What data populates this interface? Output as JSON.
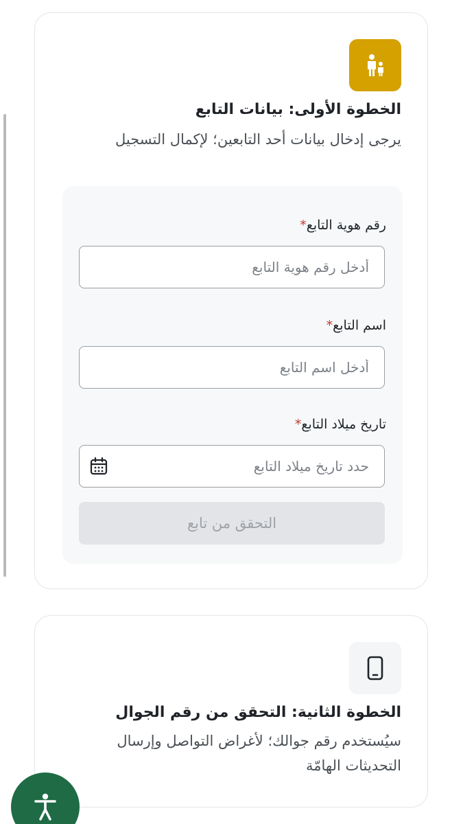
{
  "step1": {
    "icon": "parent-child-icon",
    "title": "الخطوة الأولى: بيانات التابع",
    "description": "يرجى إدخال بيانات أحد التابعين؛ لإكمال التسجيل",
    "fields": [
      {
        "label": "رقم هوية التابع",
        "required_mark": "*",
        "value": "",
        "placeholder": "أدخل رقم هوية التابع"
      },
      {
        "label": "اسم التابع",
        "required_mark": "*",
        "value": "",
        "placeholder": "أدخل اسم التابع"
      },
      {
        "label": "تاريخ ميلاد التابع",
        "required_mark": "*",
        "value": "",
        "placeholder": "حدد تاريخ ميلاد التابع",
        "icon": "calendar-icon"
      }
    ],
    "verify_button": "التحقق من تابع"
  },
  "step2": {
    "icon": "mobile-phone-icon",
    "title": "الخطوة الثانية: التحقق من رقم الجوال",
    "description": "سيُستخدم رقم جوالك؛ لأغراض التواصل وإرسال التحديثات الهامّة"
  },
  "accessibility_button": {
    "icon": "accessibility-icon"
  },
  "colors": {
    "step1_icon_bg": "#d4a100",
    "required": "#c0392b",
    "accessibility_bg": "#1e6b45",
    "disabled_button_bg": "#e2e4e7"
  }
}
